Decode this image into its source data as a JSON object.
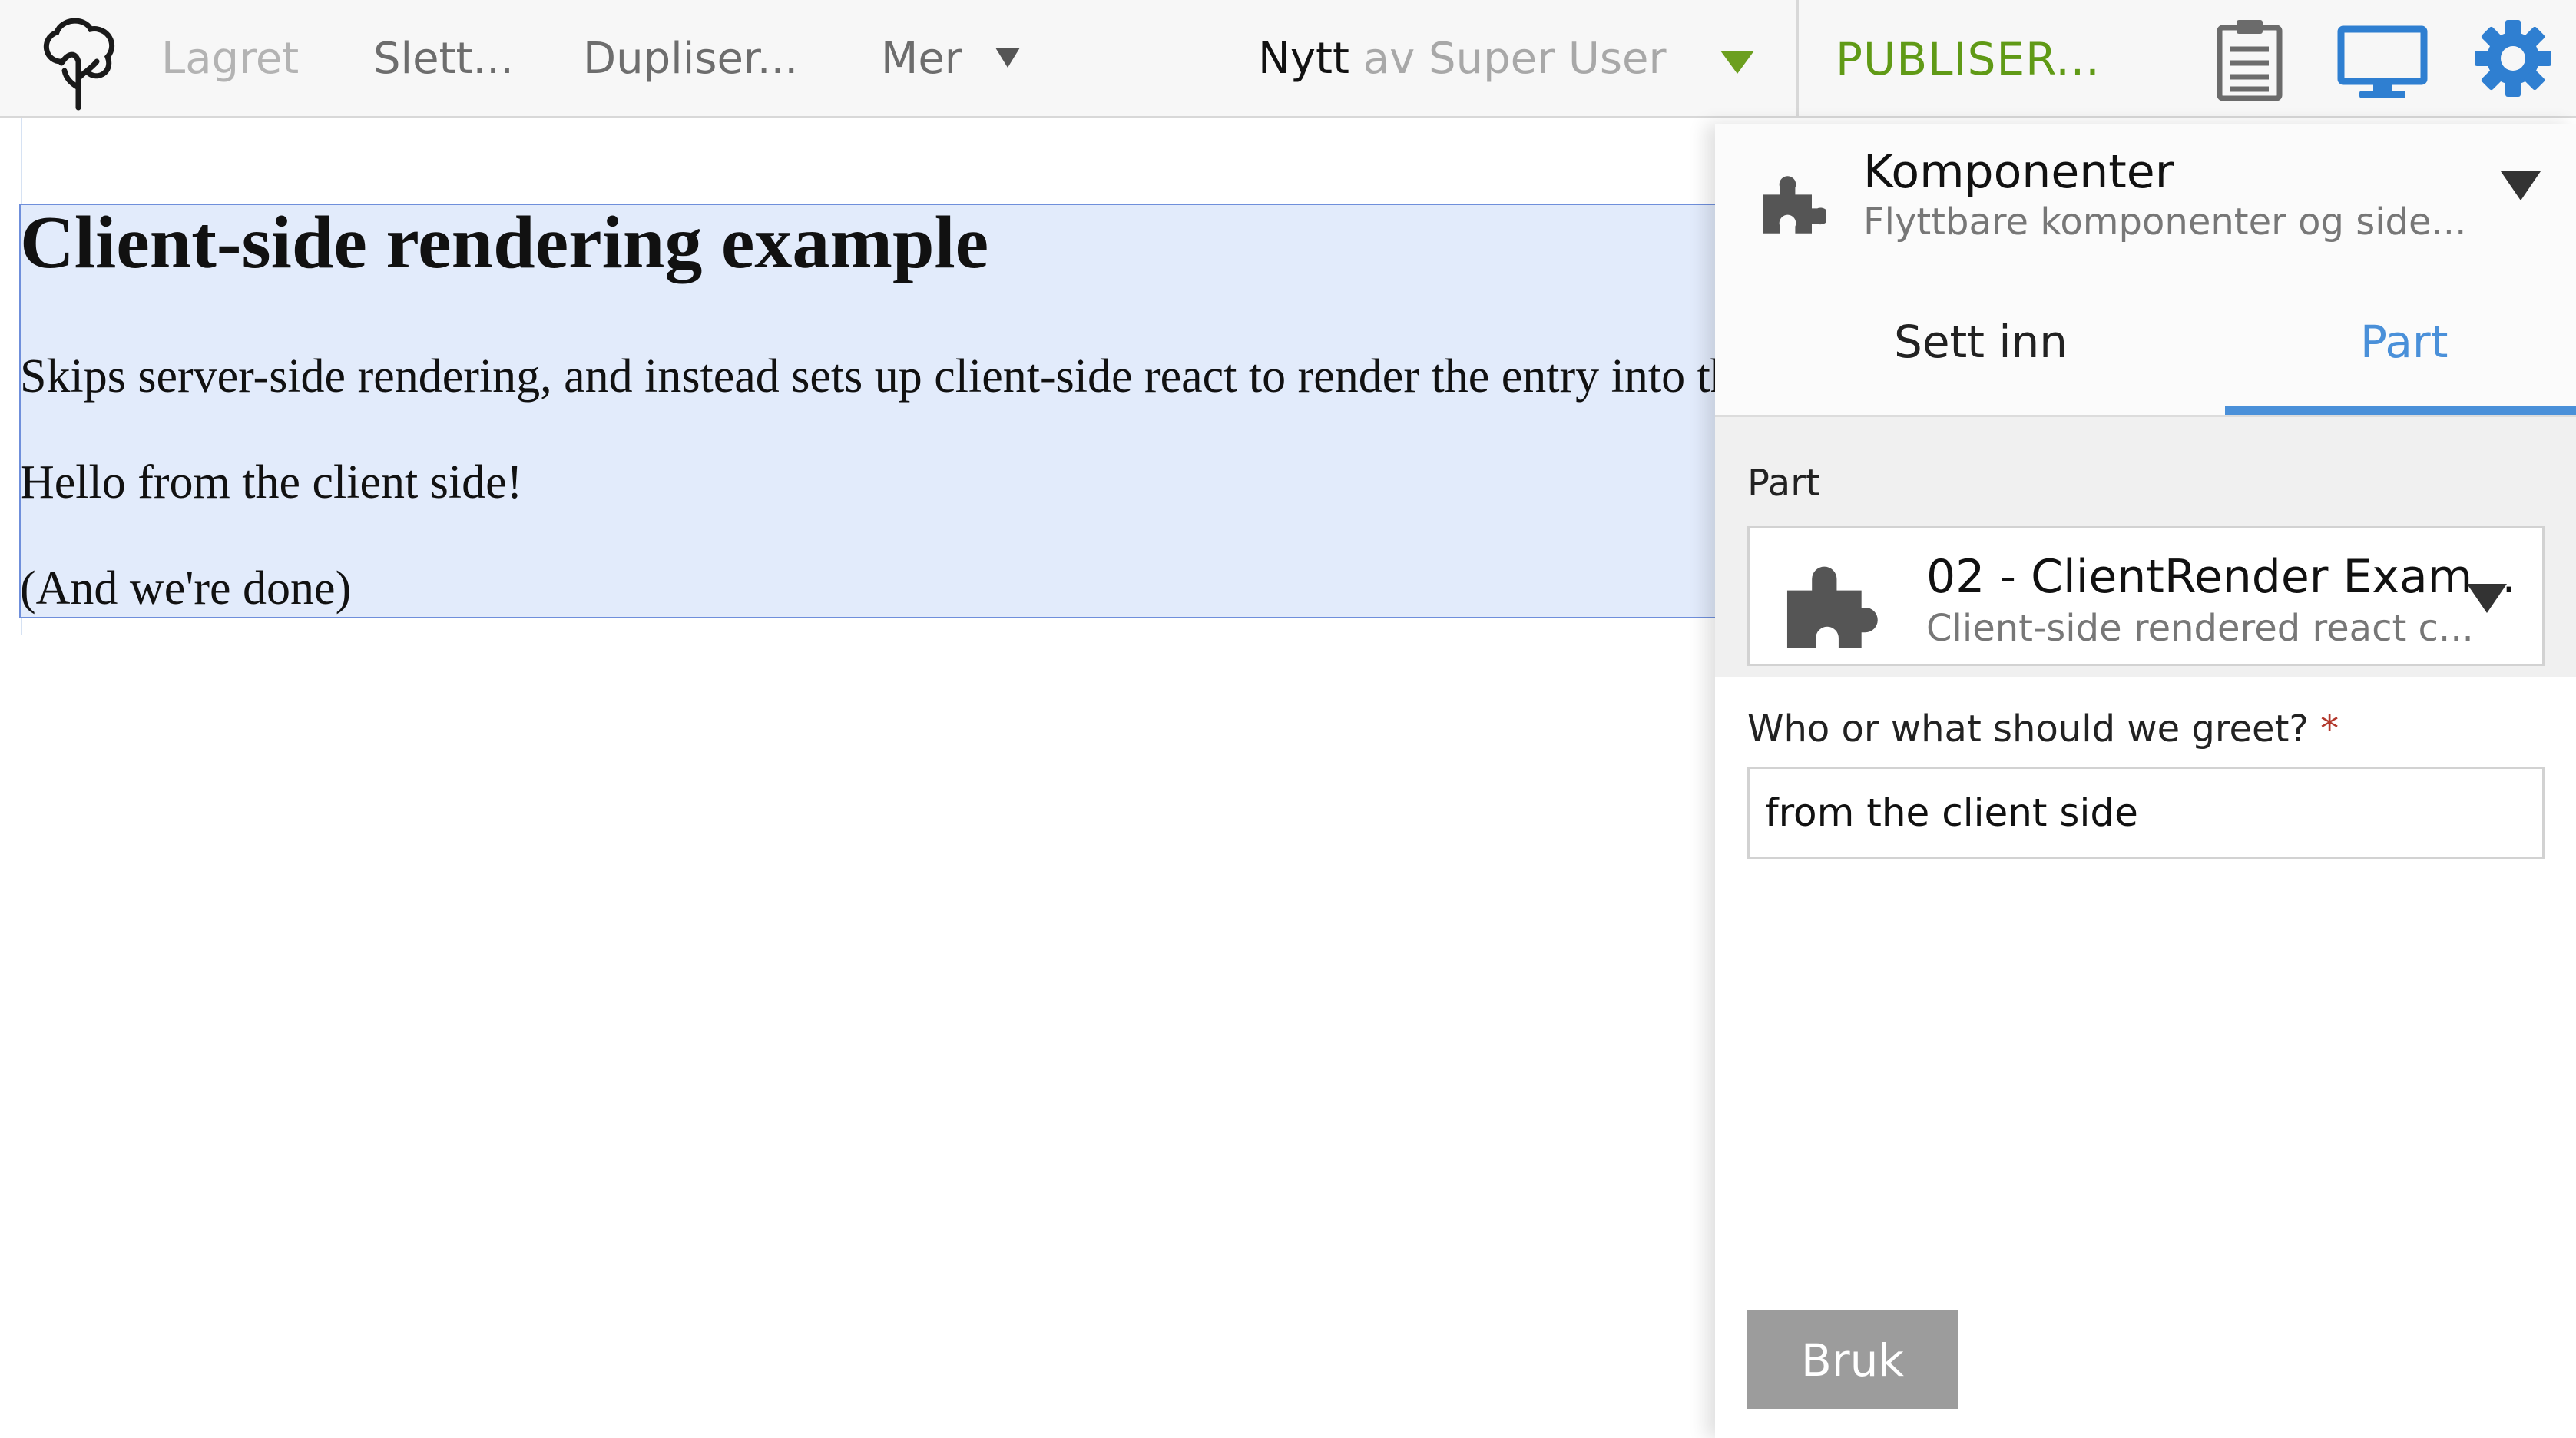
{
  "toolbar": {
    "saved_label": "Lagret",
    "delete_label": "Slett...",
    "duplicate_label": "Dupliser...",
    "more_label": "Mer",
    "status_title": "Nytt",
    "status_by": "av Super User",
    "publish_label": "PUBLISER...",
    "icons": [
      "tree-logo-icon",
      "clipboard-icon",
      "monitor-icon",
      "gear-icon"
    ]
  },
  "page": {
    "heading": "Client-side rendering example",
    "paragraph1": "Skips server-side rendering, and instead sets up client-side react to render the entry into the container below:",
    "paragraph2": "Hello from the client side!",
    "paragraph3": "(And we're done)"
  },
  "panel": {
    "title": "Komponenter",
    "subtitle": "Flyttbare komponenter og side...",
    "tabs": [
      {
        "label": "Sett inn",
        "active": false
      },
      {
        "label": "Part",
        "active": true
      }
    ],
    "part_label": "Part",
    "selected_part": {
      "title": "02 - ClientRender Exam...",
      "subtitle": "Client-side rendered react c..."
    },
    "greet_label": "Who or what should we greet?",
    "required_mark": "*",
    "greet_value": "from the client side",
    "apply_label": "Bruk"
  },
  "colors": {
    "accent_blue": "#4a90d9",
    "publish_green": "#609a16",
    "selection_fill": "#e2ebfb",
    "selection_border": "#6f8fdb"
  }
}
